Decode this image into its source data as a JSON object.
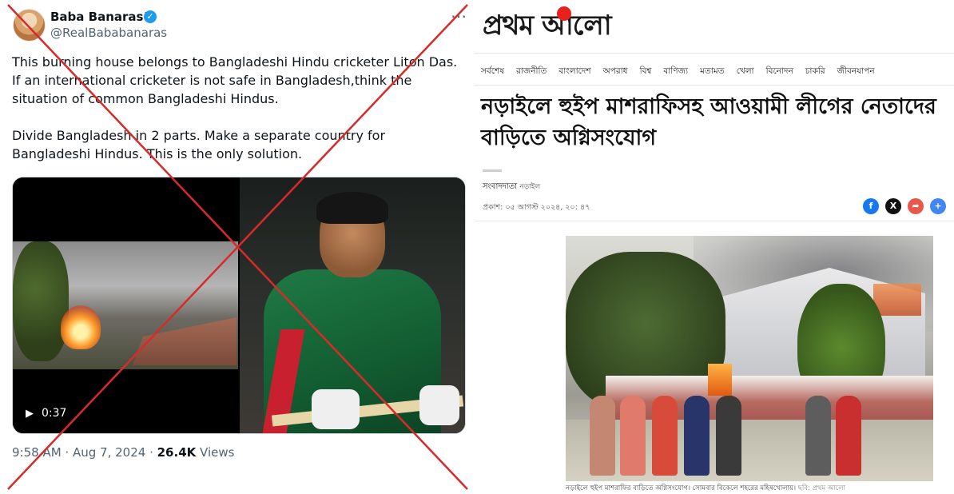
{
  "tweet": {
    "display_name": "Baba Banaras™",
    "handle": "@RealBababanaras",
    "text": "This burning house belongs to Bangladeshi Hindu cricketer Liton Das. If an international cricketer is not safe in Bangladesh,think the situation of common Bangladeshi Hindus.\n\nDivide Bangladesh in 2 parts. Make a separate country for Bangladeshi Hindus. This is the only solution.",
    "video_duration": "0:37",
    "time": "9:58 AM",
    "date": "Aug 7, 2024",
    "views_count": "26.4K",
    "views_label": "Views",
    "verified_color": "#1d9bf0",
    "overlay_cross_color": "#d92a2a"
  },
  "news": {
    "logo_text": "প্রথম আলো",
    "nav_items": [
      "সর্বশেষ",
      "রাজনীতি",
      "বাংলাদেশ",
      "অপরাধ",
      "বিশ্ব",
      "বাণিজ্য",
      "মতামত",
      "খেলা",
      "বিনোদন",
      "চাকরি",
      "জীবনযাপন"
    ],
    "headline": "নড়াইলে হুইপ মাশরাফিসহ আওয়ামী লীগের নেতাদের বাড়িতে অগ্নিসংযোগ",
    "byline": "সংবাদদাতা",
    "byline_location": "নড়াইল",
    "published": "প্রকাশ: ০৫ আগস্ট ২০২৪, ২০: ৪৭",
    "share_icons": [
      "facebook-icon",
      "x-icon",
      "share-icon",
      "plus-icon"
    ],
    "caption": "নড়াইলে হুইপ মাশরাফির বাড়িতে অগ্নিসংযোগ। সোমবার বিকেলে শহরের মহিষখোলায়।",
    "caption_credit": "ছবি: প্রথম আলো",
    "logo_dot_color": "#e8211e"
  }
}
